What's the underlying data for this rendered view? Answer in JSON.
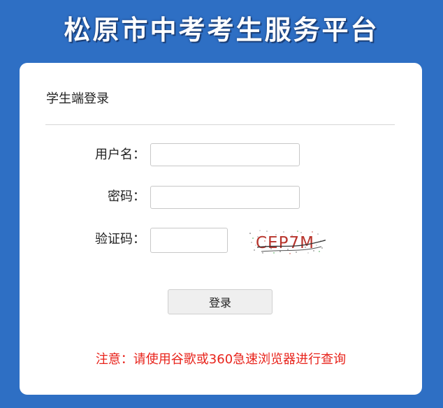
{
  "header": {
    "title": "松原市中考考生服务平台"
  },
  "login_card": {
    "title": "学生端登录",
    "username_label": "用户名：",
    "password_label": "密码：",
    "captcha_label": "验证码：",
    "username_value": "",
    "password_value": "",
    "captcha_value": "",
    "captcha_text": "CEP7M",
    "submit_label": "登录",
    "notice": "注意：请使用谷歌或360急速浏览器进行查询"
  },
  "colors": {
    "background": "#2e6fc4",
    "card": "#ffffff",
    "notice": "#e8231b"
  }
}
